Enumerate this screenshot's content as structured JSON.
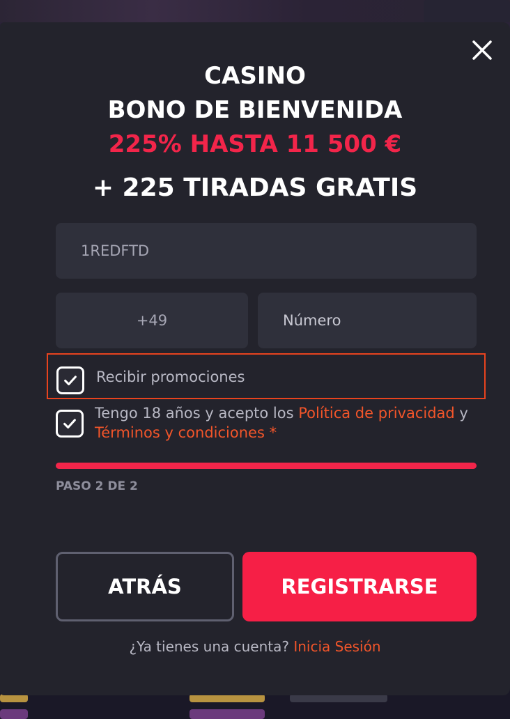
{
  "modal": {
    "title_line1": "CASINO",
    "title_line2": "BONO DE BIENVENIDA",
    "title_bonus": "225% HASTA 11 500 €",
    "title_spins": "+ 225 TIRADAS GRATIS"
  },
  "form": {
    "promo_code_value": "1REDFTD",
    "country_code_value": "+49",
    "phone_placeholder": "Número",
    "receive_promotions": {
      "checked": true,
      "label": "Recibir promociones"
    },
    "terms": {
      "checked": true,
      "text_before": "Tengo 18 años y acepto los ",
      "privacy_link": "Política de privacidad",
      "text_middle": " y ",
      "terms_link": "Términos y condiciones",
      "required_mark": " *"
    }
  },
  "progress": {
    "step_label": "PASO 2 DE 2",
    "current_step": 2,
    "total_steps": 2
  },
  "buttons": {
    "back_label": "ATRÁS",
    "register_label": "REGISTRARSE"
  },
  "footer": {
    "question": "¿Ya tienes una cuenta? ",
    "login_link": "Inicia Sesión"
  },
  "icons": {
    "close": "close-icon",
    "checkbox_checked": "checkmark-icon"
  },
  "colors": {
    "accent_red": "#f61f46",
    "link_orange": "#f2552a",
    "modal_bg": "#23232c",
    "field_bg": "#2f303b"
  }
}
